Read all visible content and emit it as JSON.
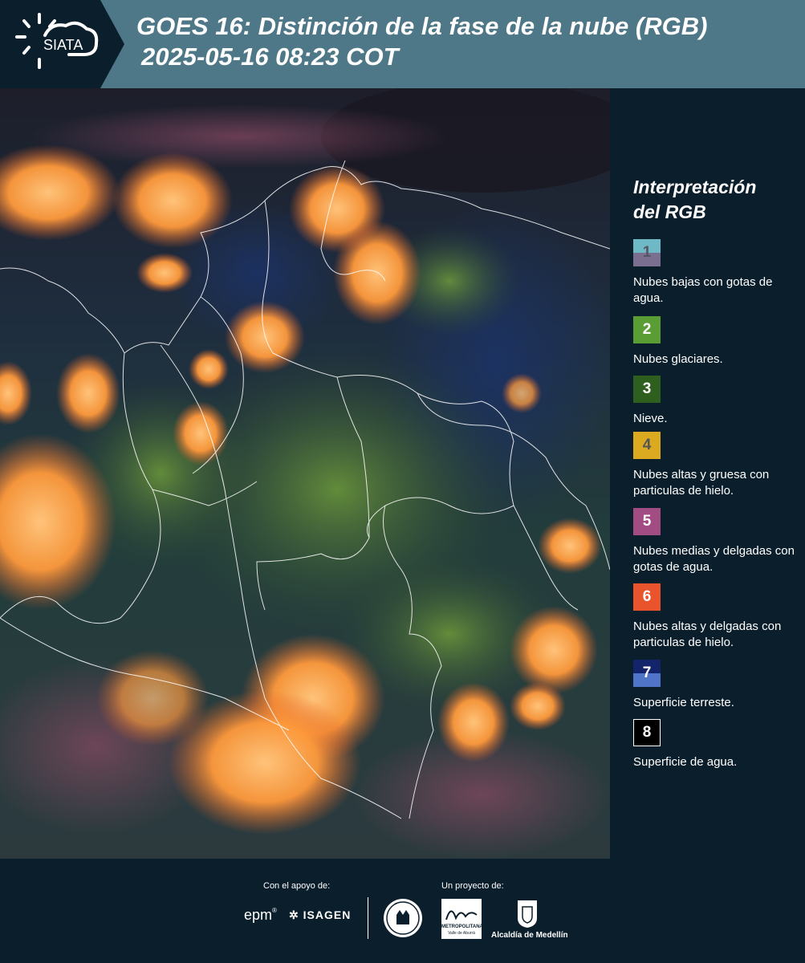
{
  "header": {
    "logo_text": "SIATA",
    "title_line1": "GOES 16: Distinción de la fase de la nube (RGB)",
    "title_line2": "2025-05-16 08:23 COT"
  },
  "legend": {
    "title_line1": "Interpretación",
    "title_line2": "del RGB",
    "items": [
      {
        "number": "1",
        "label": "Nubes bajas con gotas de agua.",
        "color_top": "#6fb8c6",
        "color_bottom": "#7a6f8f",
        "text_color": "#555566"
      },
      {
        "number": "2",
        "label": "Nubes glaciares.",
        "color_top": "#5a9d34",
        "color_bottom": "#5a9d34",
        "text_color": "#ffffff"
      },
      {
        "number": "3",
        "label": "Nieve.",
        "color_top": "#2f5f1e",
        "color_bottom": "#2f5f1e",
        "text_color": "#ffffff"
      },
      {
        "number": "4",
        "label": "Nubes altas y gruesa con particulas de hielo.",
        "color_top": "#dcaa20",
        "color_bottom": "#dcaa20",
        "text_color": "#555555"
      },
      {
        "number": "5",
        "label": "Nubes medias y delgadas con gotas de agua.",
        "color_top": "#a24c84",
        "color_bottom": "#a24c84",
        "text_color": "#ffffff"
      },
      {
        "number": "6",
        "label": "Nubes altas y delgadas con particulas de hielo.",
        "color_top": "#e9542c",
        "color_bottom": "#e9542c",
        "text_color": "#ffffff"
      },
      {
        "number": "7",
        "label": "Superficie terreste.",
        "color_top": "#13246a",
        "color_bottom": "#4f74c8",
        "text_color": "#ffffff"
      },
      {
        "number": "8",
        "label": "Superficie de agua.",
        "color_top": "#000000",
        "color_bottom": "#000000",
        "text_color": "#ffffff"
      }
    ]
  },
  "footer": {
    "support_label": "Con el apoyo de:",
    "project_label": "Un proyecto de:",
    "sponsor1": "epm",
    "sponsor2": "ISAGEN",
    "partner_area_line1": "METROPOLITANA",
    "partner_area_line2": "Valle de Aburrá",
    "partner_alcaldia": "Alcaldía de Medellín"
  }
}
